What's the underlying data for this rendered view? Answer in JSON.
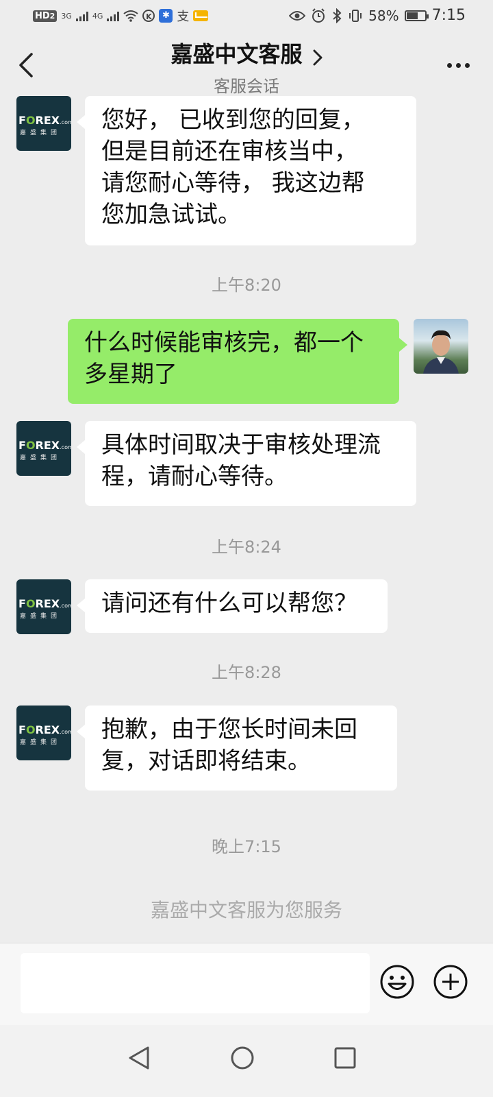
{
  "status_bar": {
    "hd_label": "HD",
    "hd_sub": "2",
    "net1": "3G",
    "net2": "4G",
    "k_label": "K",
    "alipay_label": "支",
    "battery_percent": "58%",
    "battery_level": 0.58,
    "time": "7:15"
  },
  "header": {
    "title": "嘉盛中文客服",
    "subtitle": "客服会话"
  },
  "forex_avatar": {
    "brand_f": "F",
    "brand_o": "O",
    "brand_rest": "REX",
    "brand_com": ".com",
    "brand_cn": "嘉盛集团"
  },
  "messages": [
    {
      "side": "left",
      "text": "您好， 已收到您的回复，\n但是目前还在审核当中，\n请您耐心等待， 我这边帮\n您加急试试。"
    },
    {
      "side": "right",
      "text": "什么时候能审核完，都一个\n多星期了"
    },
    {
      "side": "left",
      "text": "具体时间取决于审核处理流\n程，请耐心等待。"
    },
    {
      "side": "left",
      "text": "请问还有什么可以帮您？"
    },
    {
      "side": "left",
      "text": "抱歉，由于您长时间未回\n复，对话即将结束。"
    }
  ],
  "timestamps": [
    "上午8:20",
    "上午8:24",
    "上午8:28",
    "晚上7:15"
  ],
  "service_note": "嘉盛中文客服为您服务",
  "input": {
    "value": "",
    "placeholder": ""
  },
  "icons": {
    "back": "chevron-left-icon",
    "title_chevron": "chevron-right-icon",
    "more": "more-dots-icon",
    "emoji": "emoji-icon",
    "add": "plus-circle-icon",
    "nav_back": "triangle-back-icon",
    "nav_home": "circle-home-icon",
    "nav_recent": "square-recent-icon"
  },
  "colors": {
    "background": "#ededed",
    "own_bubble": "#95ec69",
    "other_bubble": "#ffffff",
    "forex_green": "#7ec142",
    "forex_navy": "#16343f"
  }
}
